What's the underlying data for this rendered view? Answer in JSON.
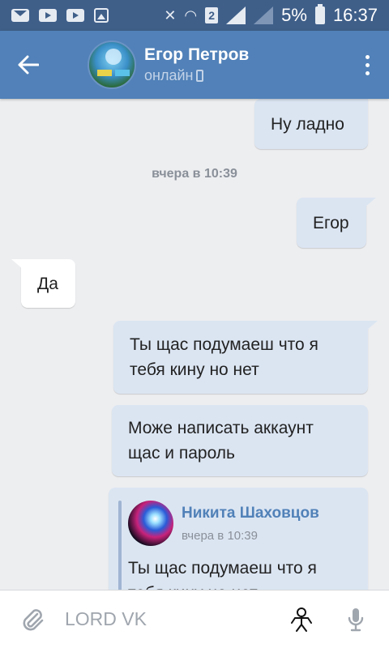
{
  "status_bar": {
    "sim_label": "2",
    "battery": "5%",
    "time": "16:37"
  },
  "header": {
    "name": "Егор Петров",
    "status": "онлайн"
  },
  "messages": {
    "m1": "Ну ладно",
    "date_separator": "вчера в 10:39",
    "m2": "Егор",
    "m3": "Да",
    "m4_line1": "Ты щас подумаеш что я",
    "m4_line2": "тебя кину но нет",
    "m5_line1": "Може написать аккаунт",
    "m5_line2": "щас и пароль"
  },
  "forwarded": {
    "author": "Никита Шаховцов",
    "time": "вчера в 10:39",
    "line1": "Ты щас подумаеш что я",
    "line2": "тебя кину но нет"
  },
  "input": {
    "placeholder": "LORD VK"
  },
  "colors": {
    "status_bar": "#3f5f89",
    "header": "#5181b8",
    "outgoing_bubble": "#dbe5f2",
    "background": "#edeef0"
  }
}
